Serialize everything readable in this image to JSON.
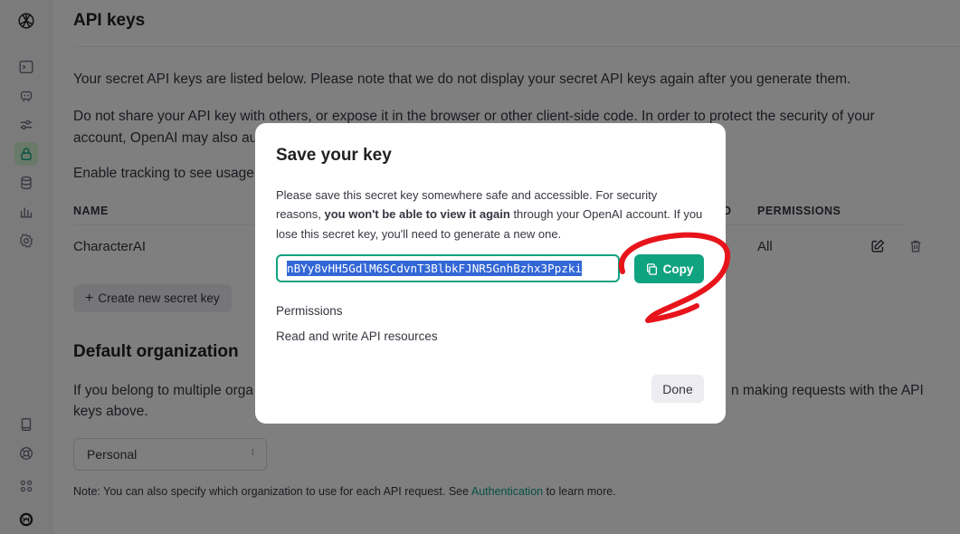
{
  "page": {
    "title": "API keys",
    "intro": "Your secret API keys are listed below. Please note that we do not display your secret API keys again after you generate them.",
    "warning": "Do not share your API key with others, or expose it in the browser or other client-side code. In order to protect the security of your account, OpenAI may also au",
    "tracking": "Enable tracking to see usage",
    "table": {
      "headers": {
        "name": "NAME",
        "created_partial": "D",
        "permissions": "PERMISSIONS"
      },
      "rows": [
        {
          "name": "CharacterAI",
          "permissions": "All"
        }
      ]
    },
    "create_button": "Create new secret key",
    "default_org_title": "Default organization",
    "default_org_text_left": "If you belong to multiple orga",
    "default_org_text_right": "n making requests with the API",
    "default_org_text_line2": "keys above.",
    "org_select_value": "Personal",
    "note_prefix": "Note: You can also specify which organization to use for each API request. See ",
    "note_link": "Authentication",
    "note_suffix": " to learn more."
  },
  "modal": {
    "title": "Save your key",
    "text_1": "Please save this secret key somewhere safe and accessible. For security reasons, ",
    "text_bold": "you won't be able to view it again",
    "text_2": " through your OpenAI account. If you lose this secret key, you'll need to generate a new one.",
    "key_value": "nBYy8vHH5GdlM6SCdvnT3BlbkFJNR5GnhBzhx3Ppzki",
    "copy_label": "Copy",
    "permissions_label": "Permissions",
    "permissions_value": "Read and write API resources",
    "done_label": "Done"
  },
  "colors": {
    "accent": "#10a37f",
    "selection": "#3367d6",
    "annotation": "#e8141b",
    "overlay": "rgba(0,0,0,0.5)"
  },
  "icons": {
    "sidebar_top": [
      "openai-logo-icon",
      "terminal-icon",
      "assistant-robot-icon",
      "sliders-icon",
      "lock-icon",
      "database-icon",
      "bar-chart-icon",
      "gear-icon"
    ],
    "sidebar_bottom": [
      "book-icon",
      "help-lifebuoy-icon",
      "apps-grid-icon",
      "user-avatar-icon"
    ]
  }
}
